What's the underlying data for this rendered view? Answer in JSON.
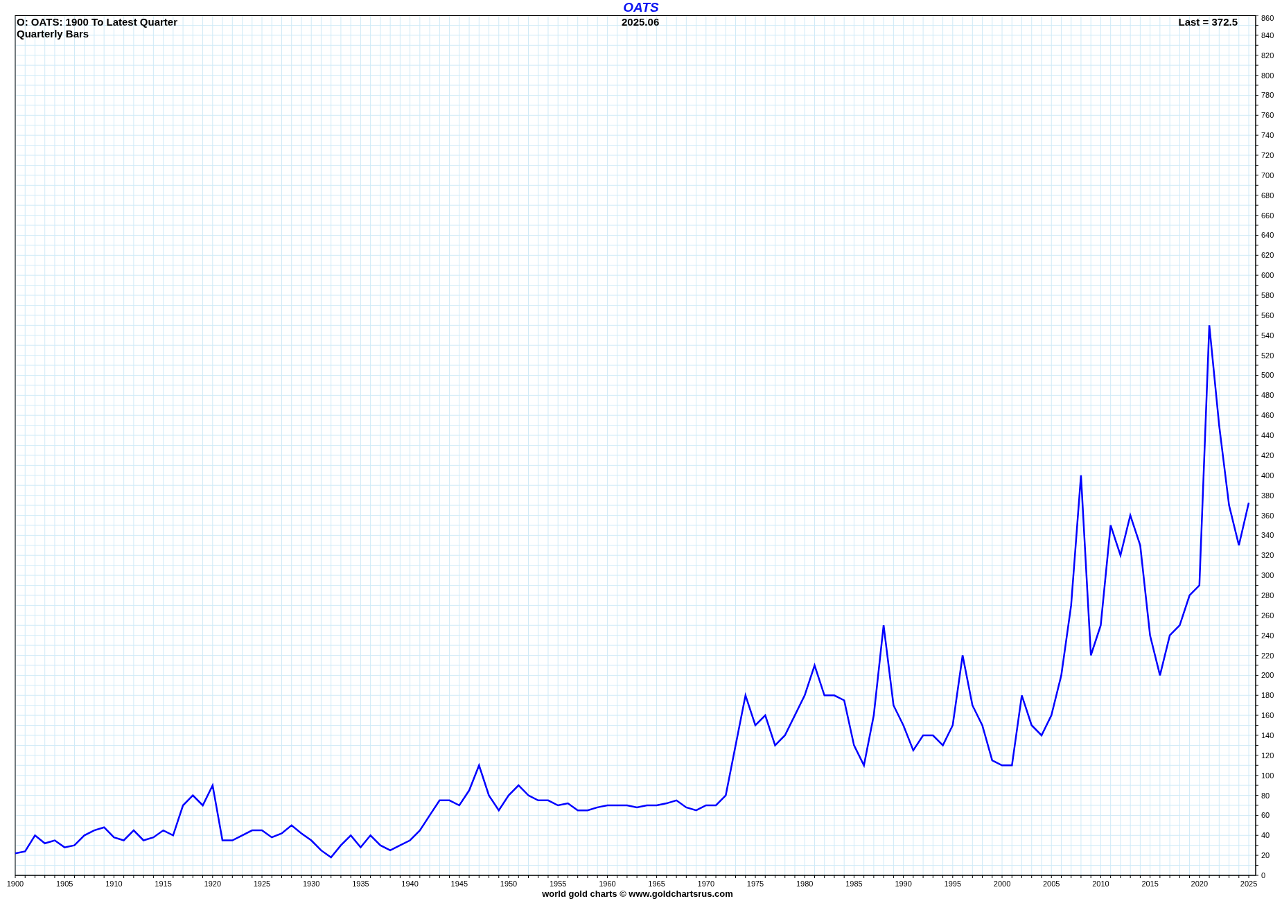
{
  "chart": {
    "header_left": [
      "O: OATS: 1900 To Latest Quarter",
      "Quarterly Bars"
    ],
    "header_center": "2025.06",
    "header_right": "Last = 372.5",
    "chart_data": {
      "type": "line",
      "title": "OATS",
      "grid": true,
      "xlim": [
        1900,
        2025.7
      ],
      "ylim": [
        0,
        860
      ],
      "xticks": [
        1900,
        1905,
        1910,
        1915,
        1920,
        1925,
        1930,
        1935,
        1940,
        1945,
        1950,
        1955,
        1960,
        1965,
        1970,
        1975,
        1980,
        1985,
        1990,
        1995,
        2000,
        2005,
        2010,
        2015,
        2020,
        2025
      ],
      "yticks": [
        0,
        20,
        40,
        60,
        80,
        100,
        120,
        140,
        160,
        180,
        200,
        220,
        240,
        260,
        280,
        300,
        320,
        340,
        360,
        380,
        400,
        420,
        440,
        460,
        480,
        500,
        520,
        540,
        560,
        580,
        600,
        620,
        640,
        660,
        680,
        700,
        720,
        740,
        760,
        780,
        800,
        820,
        840,
        860
      ],
      "x": [
        1900,
        1901,
        1902,
        1903,
        1904,
        1905,
        1906,
        1907,
        1908,
        1909,
        1910,
        1911,
        1912,
        1913,
        1914,
        1915,
        1916,
        1917,
        1918,
        1919,
        1920,
        1921,
        1922,
        1923,
        1924,
        1925,
        1926,
        1927,
        1928,
        1929,
        1930,
        1931,
        1932,
        1933,
        1934,
        1935,
        1936,
        1937,
        1938,
        1939,
        1940,
        1941,
        1942,
        1943,
        1944,
        1945,
        1946,
        1947,
        1948,
        1949,
        1950,
        1951,
        1952,
        1953,
        1954,
        1955,
        1956,
        1957,
        1958,
        1959,
        1960,
        1961,
        1962,
        1963,
        1964,
        1965,
        1966,
        1967,
        1968,
        1969,
        1970,
        1971,
        1972,
        1973,
        1974,
        1975,
        1976,
        1977,
        1978,
        1979,
        1980,
        1981,
        1982,
        1983,
        1984,
        1985,
        1986,
        1987,
        1988,
        1989,
        1990,
        1991,
        1992,
        1993,
        1994,
        1995,
        1996,
        1997,
        1998,
        1999,
        2000,
        2001,
        2002,
        2003,
        2004,
        2005,
        2006,
        2007,
        2008,
        2009,
        2010,
        2011,
        2012,
        2013,
        2014,
        2015,
        2016,
        2017,
        2018,
        2019,
        2020,
        2021,
        2022,
        2023,
        2024,
        2025
      ],
      "series": [
        {
          "color": "#0000ff",
          "values": [
            22,
            24,
            40,
            32,
            35,
            28,
            30,
            40,
            45,
            48,
            38,
            35,
            45,
            35,
            38,
            45,
            40,
            70,
            80,
            70,
            90,
            35,
            35,
            40,
            45,
            45,
            38,
            42,
            50,
            42,
            35,
            25,
            18,
            30,
            40,
            28,
            40,
            30,
            25,
            30,
            35,
            45,
            60,
            75,
            75,
            70,
            85,
            110,
            80,
            65,
            80,
            90,
            80,
            75,
            75,
            70,
            72,
            65,
            65,
            68,
            70,
            70,
            70,
            68,
            70,
            70,
            72,
            75,
            68,
            65,
            70,
            70,
            80,
            130,
            180,
            150,
            160,
            130,
            140,
            160,
            180,
            210,
            180,
            180,
            175,
            130,
            110,
            160,
            250,
            170,
            150,
            125,
            140,
            140,
            130,
            150,
            220,
            170,
            150,
            115,
            110,
            110,
            180,
            150,
            140,
            160,
            200,
            270,
            400,
            220,
            250,
            350,
            320,
            360,
            330,
            240,
            200,
            240,
            250,
            280,
            290,
            550,
            450,
            370,
            330,
            372.5
          ]
        }
      ]
    }
  },
  "footer": "world gold charts © www.goldchartsrus.com"
}
